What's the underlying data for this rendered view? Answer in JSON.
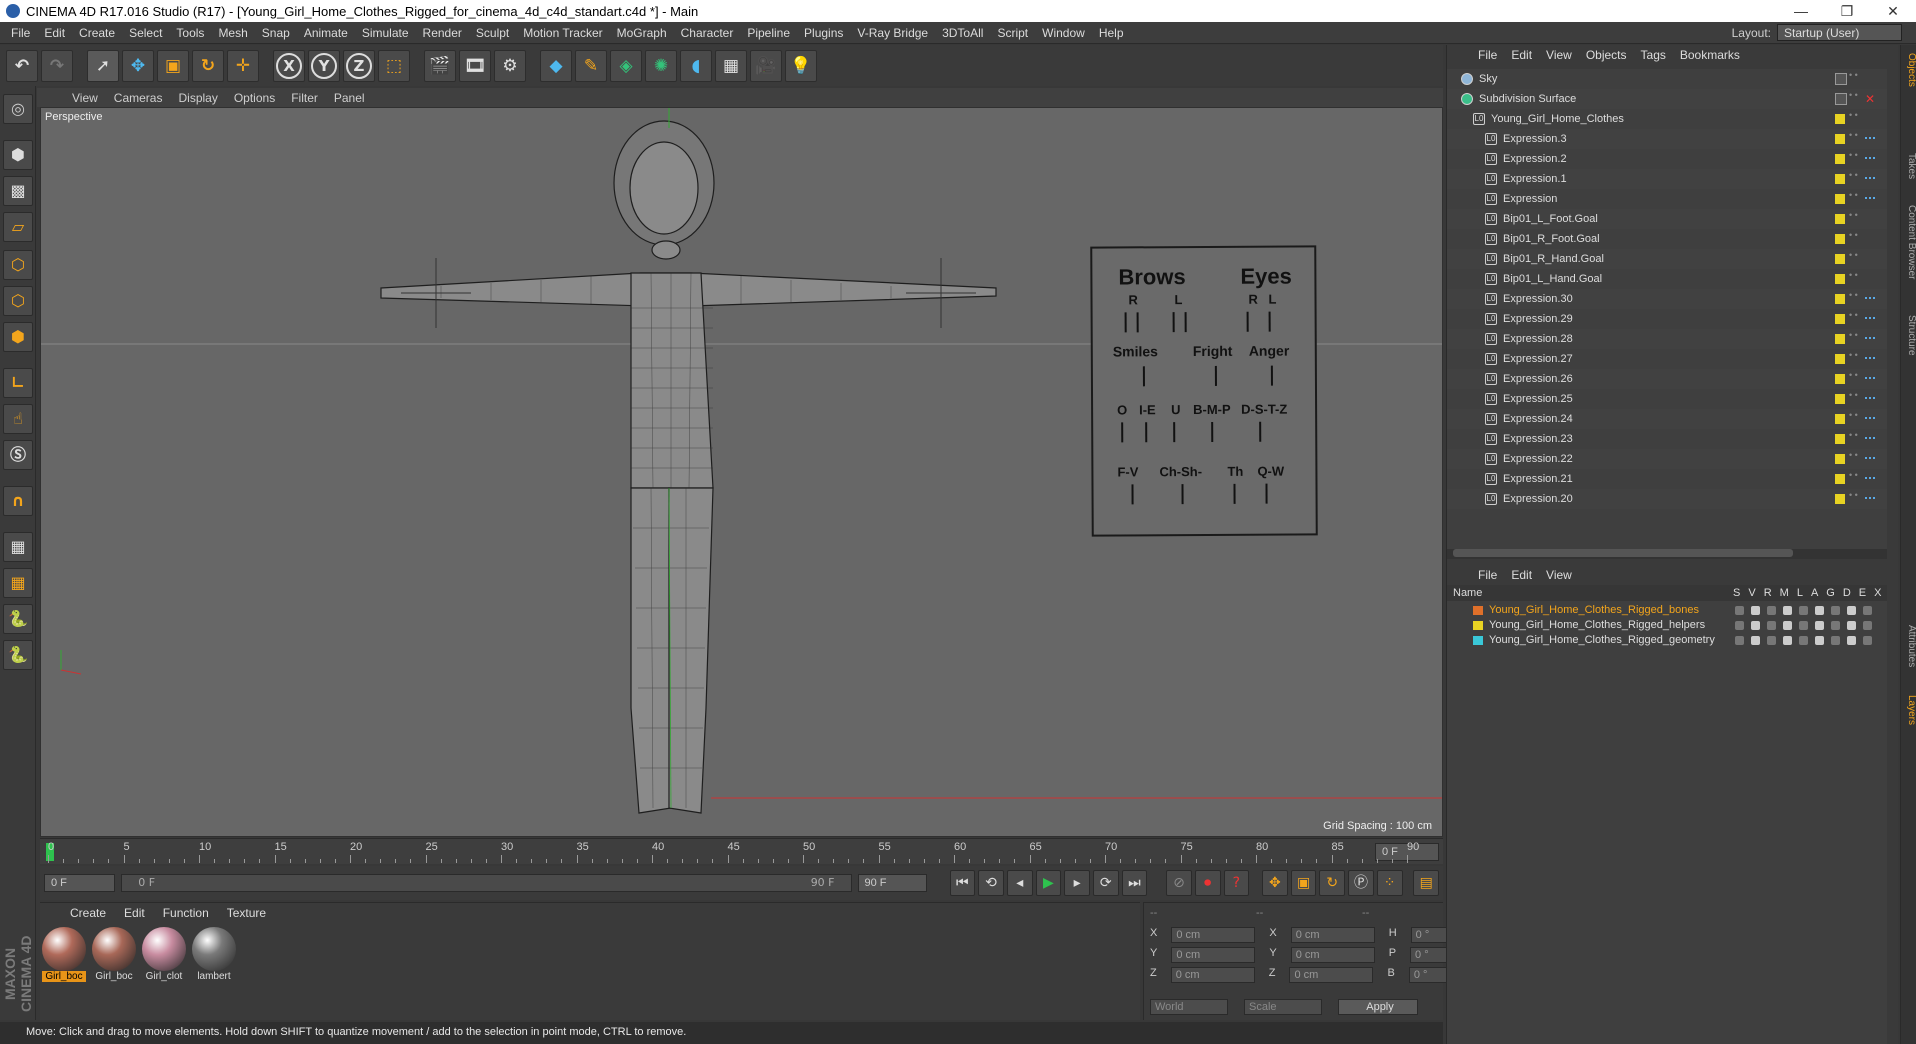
{
  "window": {
    "title": "CINEMA 4D R17.016 Studio (R17) - [Young_Girl_Home_Clothes_Rigged_for_cinema_4d_c4d_standart.c4d *] - Main",
    "controls": [
      "—",
      "❐",
      "✕"
    ]
  },
  "menubar": {
    "items": [
      "File",
      "Edit",
      "Create",
      "Select",
      "Tools",
      "Mesh",
      "Snap",
      "Animate",
      "Simulate",
      "Render",
      "Sculpt",
      "Motion Tracker",
      "MoGraph",
      "Character",
      "Pipeline",
      "Plugins",
      "V-Ray Bridge",
      "3DToAll",
      "Script",
      "Window",
      "Help"
    ],
    "layout_label": "Layout:",
    "layout_value": "Startup (User)"
  },
  "viewport": {
    "menu": [
      "View",
      "Cameras",
      "Display",
      "Options",
      "Filter",
      "Panel"
    ],
    "label": "Perspective",
    "grid_spacing": "Grid Spacing : 100 cm",
    "chart": {
      "brows": "Brows",
      "eyes": "Eyes",
      "r1": "R",
      "l1": "L",
      "r2": "R",
      "l2": "L",
      "smiles": "Smiles",
      "fright": "Fright",
      "anger": "Anger",
      "o": "O",
      "ie": "I-E",
      "u": "U",
      "bmp": "B-M-P",
      "dstz": "D-S-T-Z",
      "fv": "F-V",
      "chsh": "Ch-Sh-",
      "th": "Th",
      "qw": "Q-W"
    }
  },
  "timeline": {
    "ticks": [
      "0",
      "5",
      "10",
      "15",
      "20",
      "25",
      "30",
      "35",
      "40",
      "45",
      "50",
      "55",
      "60",
      "65",
      "70",
      "75",
      "80",
      "85",
      "90"
    ],
    "frame_end_field": "0 F"
  },
  "playback": {
    "start_field": "0 F",
    "range_start": "0 F",
    "range_end": "90 F",
    "end_field": "90 F"
  },
  "materials": {
    "menu": [
      "Create",
      "Edit",
      "Function",
      "Texture"
    ],
    "items": [
      {
        "name": "Girl_boc",
        "selected": true,
        "color": "#b06a5a"
      },
      {
        "name": "Girl_boc",
        "selected": false,
        "color": "#a86858"
      },
      {
        "name": "Girl_clot",
        "selected": false,
        "color": "#c88ca0"
      },
      {
        "name": "lambert",
        "selected": false,
        "color": "#7a7a7a"
      }
    ]
  },
  "coords": {
    "header": [
      "--",
      "--",
      "--"
    ],
    "rows": [
      {
        "a": "X",
        "av": "0 cm",
        "b": "X",
        "bv": "0 cm",
        "c": "H",
        "cv": "0 °"
      },
      {
        "a": "Y",
        "av": "0 cm",
        "b": "Y",
        "bv": "0 cm",
        "c": "P",
        "cv": "0 °"
      },
      {
        "a": "Z",
        "av": "0 cm",
        "b": "Z",
        "bv": "0 cm",
        "c": "B",
        "cv": "0 °"
      }
    ],
    "world": "World",
    "scale": "Scale",
    "apply": "Apply"
  },
  "status": "Move: Click and drag to move elements. Hold down SHIFT to quantize movement / add to the selection in point mode, CTRL to remove.",
  "brand": "MAXON CINEMA 4D",
  "objects": {
    "menu": [
      "File",
      "Edit",
      "View",
      "Objects",
      "Tags",
      "Bookmarks"
    ],
    "items": [
      {
        "name": "Sky",
        "indent": 0,
        "kind": "sky"
      },
      {
        "name": "Subdivision Surface",
        "indent": 0,
        "kind": "sub"
      },
      {
        "name": "Young_Girl_Home_Clothes",
        "indent": 1,
        "kind": "null"
      },
      {
        "name": "Expression.3",
        "indent": 2,
        "kind": "null"
      },
      {
        "name": "Expression.2",
        "indent": 2,
        "kind": "null"
      },
      {
        "name": "Expression.1",
        "indent": 2,
        "kind": "null"
      },
      {
        "name": "Expression",
        "indent": 2,
        "kind": "null"
      },
      {
        "name": "Bip01_L_Foot.Goal",
        "indent": 2,
        "kind": "null"
      },
      {
        "name": "Bip01_R_Foot.Goal",
        "indent": 2,
        "kind": "null"
      },
      {
        "name": "Bip01_R_Hand.Goal",
        "indent": 2,
        "kind": "null"
      },
      {
        "name": "Bip01_L_Hand.Goal",
        "indent": 2,
        "kind": "null"
      },
      {
        "name": "Expression.30",
        "indent": 2,
        "kind": "null"
      },
      {
        "name": "Expression.29",
        "indent": 2,
        "kind": "null"
      },
      {
        "name": "Expression.28",
        "indent": 2,
        "kind": "null"
      },
      {
        "name": "Expression.27",
        "indent": 2,
        "kind": "null"
      },
      {
        "name": "Expression.26",
        "indent": 2,
        "kind": "null"
      },
      {
        "name": "Expression.25",
        "indent": 2,
        "kind": "null"
      },
      {
        "name": "Expression.24",
        "indent": 2,
        "kind": "null"
      },
      {
        "name": "Expression.23",
        "indent": 2,
        "kind": "null"
      },
      {
        "name": "Expression.22",
        "indent": 2,
        "kind": "null"
      },
      {
        "name": "Expression.21",
        "indent": 2,
        "kind": "null"
      },
      {
        "name": "Expression.20",
        "indent": 2,
        "kind": "null"
      }
    ]
  },
  "layers": {
    "menu": [
      "File",
      "Edit",
      "View"
    ],
    "columns": "Name",
    "flags": [
      "S",
      "V",
      "R",
      "M",
      "L",
      "A",
      "G",
      "D",
      "E",
      "X"
    ],
    "items": [
      {
        "name": "Young_Girl_Home_Clothes_Rigged_bones",
        "color": "#e0702a",
        "text_color": "#f3a51c"
      },
      {
        "name": "Young_Girl_Home_Clothes_Rigged_helpers",
        "color": "#e8d323",
        "text_color": "#dddddd"
      },
      {
        "name": "Young_Girl_Home_Clothes_Rigged_geometry",
        "color": "#3ac8d8",
        "text_color": "#dddddd"
      }
    ]
  },
  "side_tabs": [
    "Objects",
    "Takes",
    "Content Browser",
    "Structure",
    "Attributes",
    "Layers"
  ]
}
